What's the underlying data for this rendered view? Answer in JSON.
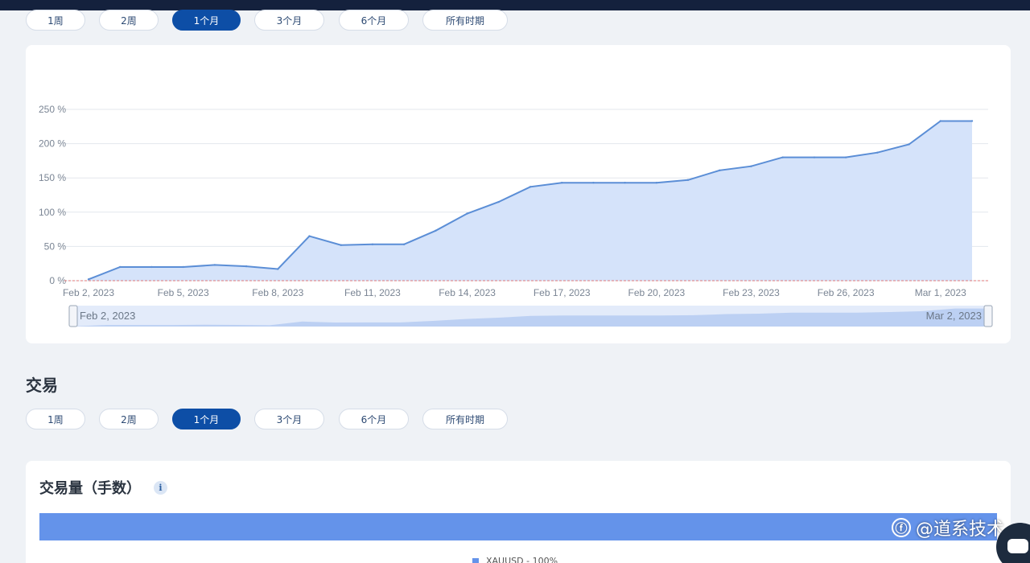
{
  "periods_top": [
    "1周",
    "2周",
    "1个月",
    "3个月",
    "6个月",
    "所有时期"
  ],
  "periods_bottom": [
    "1周",
    "2周",
    "1个月",
    "3个月",
    "6个月",
    "所有时期"
  ],
  "active_period": "1个月",
  "growth_chart": {
    "title": "",
    "navigator_start_label": "Feb 2, 2023",
    "navigator_end_label": "Mar 2, 2023"
  },
  "chart_data": {
    "type": "area",
    "x": [
      "Feb 2",
      "Feb 3",
      "Feb 4",
      "Feb 5",
      "Feb 6",
      "Feb 7",
      "Feb 8",
      "Feb 9",
      "Feb 10",
      "Feb 11",
      "Feb 12",
      "Feb 13",
      "Feb 14",
      "Feb 15",
      "Feb 16",
      "Feb 17",
      "Feb 18",
      "Feb 19",
      "Feb 20",
      "Feb 21",
      "Feb 22",
      "Feb 23",
      "Feb 24",
      "Feb 25",
      "Feb 26",
      "Feb 27",
      "Feb 28",
      "Mar 1",
      "Mar 2"
    ],
    "values": [
      2,
      20,
      20,
      20,
      23,
      21,
      17,
      65,
      52,
      53,
      53,
      73,
      98,
      115,
      137,
      143,
      143,
      143,
      143,
      147,
      161,
      167,
      180,
      180,
      180,
      187,
      199,
      233,
      233
    ],
    "x_tick_labels": [
      "Feb 2, 2023",
      "Feb 5, 2023",
      "Feb 8, 2023",
      "Feb 11, 2023",
      "Feb 14, 2023",
      "Feb 17, 2023",
      "Feb 20, 2023",
      "Feb 23, 2023",
      "Feb 26, 2023",
      "Mar 1, 2023"
    ],
    "y_tick_labels": [
      "0 %",
      "50 %",
      "100 %",
      "150 %",
      "200 %",
      "250 %"
    ],
    "ylim": [
      0,
      250
    ],
    "grid": true,
    "colors": {
      "line": "#5b8ed6",
      "fill": "#d5e3fa",
      "zero_line": "#e07a7a"
    }
  },
  "trades_section": {
    "title": "交易",
    "volume_title": "交易量（手数）",
    "info_icon": "i",
    "legend_label": "XAUUSD - 100%",
    "volume_bar_color": "#6493ea"
  },
  "watermark": {
    "logo": "ⓕ",
    "text": "@道系技术"
  }
}
